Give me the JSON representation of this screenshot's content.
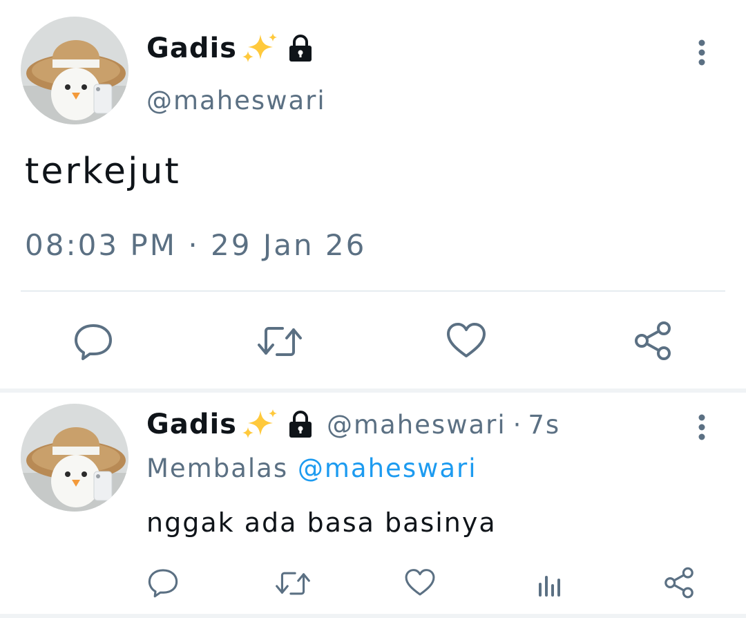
{
  "tweet": {
    "display_name": "Gadis",
    "handle": "@maheswari",
    "text": "terkejut",
    "time": "08:03 PM",
    "date": "29 Jan 26",
    "separator": "·",
    "icons": {
      "sparkle": "sparkles-emoji",
      "lock": "lock-icon",
      "more": "more-vertical-icon",
      "reply": "reply-icon",
      "retweet": "retweet-icon",
      "like": "heart-icon",
      "share": "share-icon"
    }
  },
  "reply": {
    "display_name": "Gadis",
    "handle": "@maheswari",
    "separator": "·",
    "time_ago": "7s",
    "replying_label": "Membalas",
    "replying_to": "@maheswari",
    "text": "nggak ada basa basinya",
    "icons": {
      "reply": "reply-icon",
      "retweet": "retweet-icon",
      "like": "heart-icon",
      "analytics": "analytics-icon",
      "share": "share-icon"
    }
  },
  "colors": {
    "text_primary": "#0f1419",
    "text_secondary": "#5b7083",
    "link": "#1d9bf0",
    "divider": "#e6ecf0",
    "icon": "#5b7083"
  }
}
